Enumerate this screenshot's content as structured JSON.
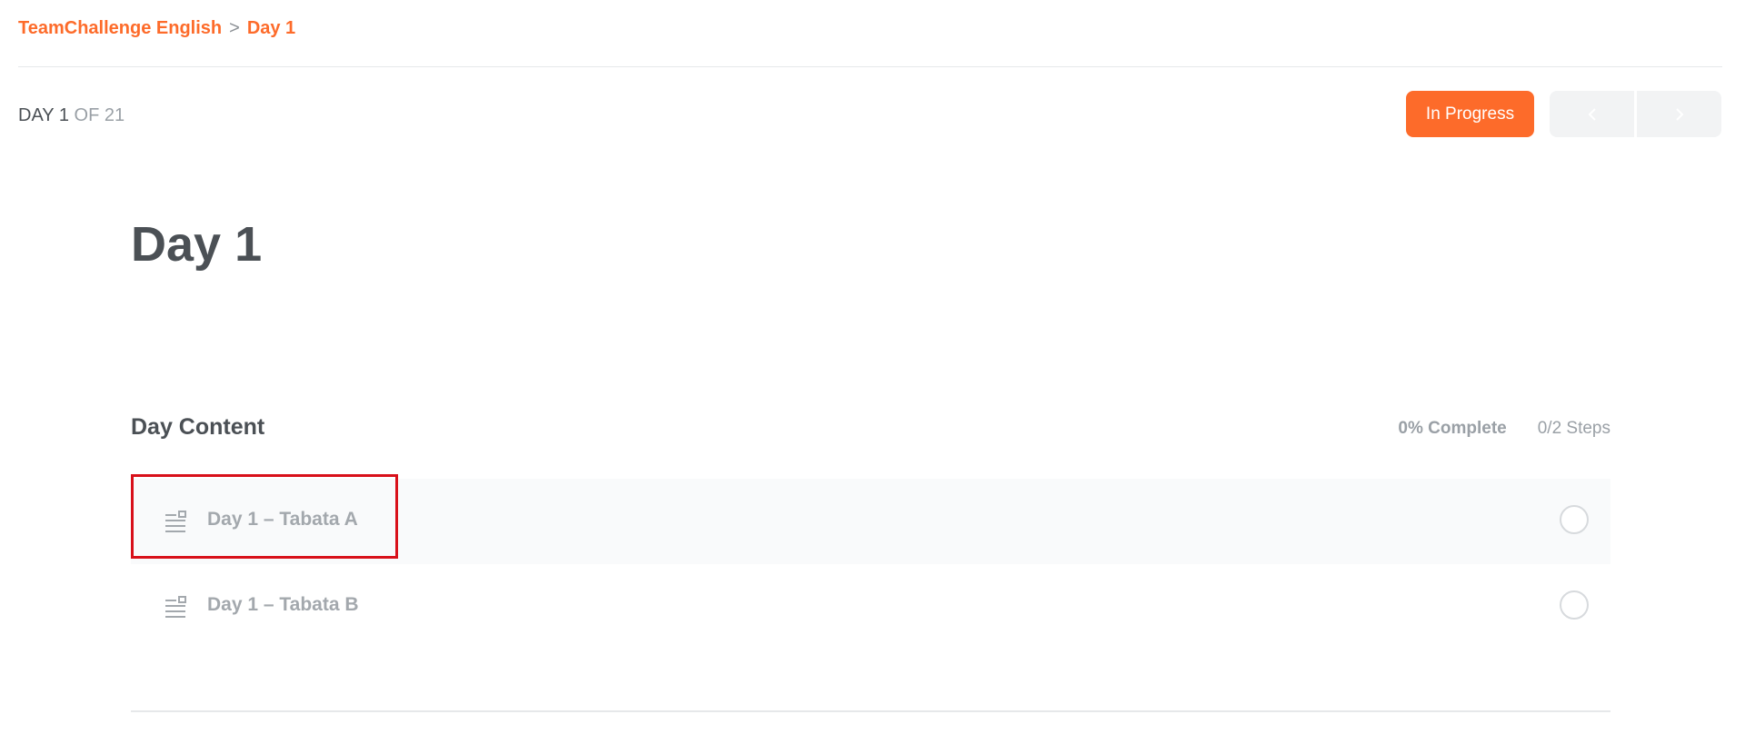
{
  "breadcrumb": {
    "course": "TeamChallenge English",
    "separator": ">",
    "current": "Day 1"
  },
  "progress_header": {
    "day_label": "DAY 1",
    "of_total": "OF 21",
    "status_button": "In Progress",
    "prev_icon": "chevron-left-icon",
    "next_icon": "chevron-right-icon"
  },
  "page": {
    "title": "Day 1"
  },
  "content_section": {
    "title": "Day Content",
    "percent_complete": "0% Complete",
    "steps": "0/2 Steps",
    "items": [
      {
        "label": "Day 1 – Tabata A",
        "icon": "lesson-text-icon",
        "completed": false
      },
      {
        "label": "Day 1 – Tabata B",
        "icon": "lesson-text-icon",
        "completed": false
      }
    ]
  },
  "colors": {
    "accent": "#fd6b2a",
    "text": "#4b5055",
    "muted": "#a3a8ad",
    "highlight": "#d8101a"
  }
}
